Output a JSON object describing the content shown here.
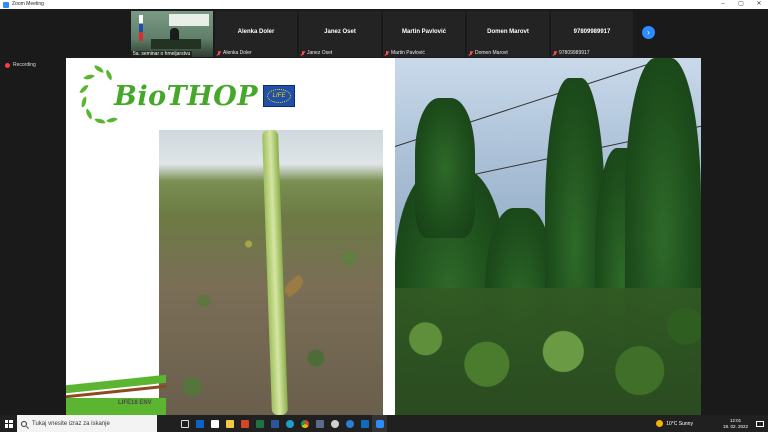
{
  "window": {
    "title": "Zoom Meeting"
  },
  "participants": [
    {
      "name": "",
      "caption": "5a. seminar o hmeljarstvu",
      "muted": false,
      "has_video": true
    },
    {
      "name": "Alenka Doler",
      "caption": "Alenka Doler",
      "muted": true
    },
    {
      "name": "Janez Oset",
      "caption": "Janez Oset",
      "muted": true
    },
    {
      "name": "Martin Pavlović",
      "caption": "Martin Pavlović",
      "muted": true
    },
    {
      "name": "Domen Marovt",
      "caption": "Domen Marovt",
      "muted": true
    },
    {
      "name": "97809989917",
      "caption": "97809989917",
      "muted": true
    }
  ],
  "recording": {
    "label": "Recording"
  },
  "slide": {
    "logo_text": "BioTHOP",
    "eu_badge_text": "LIFE",
    "footer_text": "LIFE18 ENV",
    "colors": {
      "brand_green": "#5cb531",
      "brown_stripe": "#8a4b1e"
    }
  },
  "taskbar": {
    "search_placeholder": "Tukaj vnesite izraz za iskanje",
    "weather": "10°C  Sunny",
    "time": "12:01",
    "date": "18. 02. 2022"
  },
  "colors": {
    "zoom_blue": "#2d8cff",
    "recording_red": "#ff3b3b"
  },
  "icons": {
    "titlebar": [
      "minimize-icon",
      "maximize-icon",
      "close-icon"
    ],
    "taskbar_apps": [
      "task-view-icon",
      "outlook-icon",
      "store-icon",
      "file-explorer-icon",
      "powerpoint-icon",
      "excel-icon",
      "word-icon",
      "edge-icon",
      "chrome-icon",
      "security-icon",
      "teams-icon",
      "onedrive-icon",
      "outlook-mail-icon",
      "zoom-icon"
    ]
  }
}
